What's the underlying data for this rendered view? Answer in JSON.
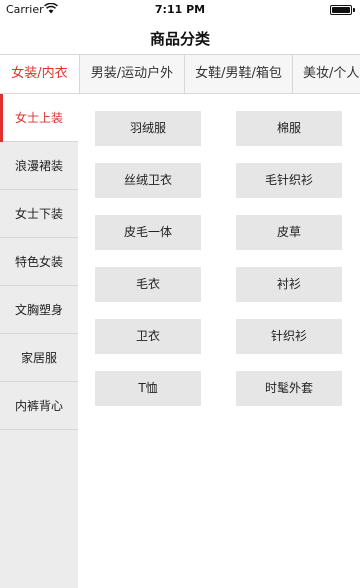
{
  "status_bar": {
    "carrier": "Carrier",
    "time": "7:11 PM"
  },
  "nav": {
    "title": "商品分类"
  },
  "tabs": [
    {
      "label": "女装/内衣",
      "active": true
    },
    {
      "label": "男装/运动户外",
      "active": false
    },
    {
      "label": "女鞋/男鞋/箱包",
      "active": false
    },
    {
      "label": "美妆/个人",
      "active": false
    }
  ],
  "sidebar": {
    "items": [
      {
        "label": "女士上装",
        "active": true
      },
      {
        "label": "浪漫裙装",
        "active": false
      },
      {
        "label": "女士下装",
        "active": false
      },
      {
        "label": "特色女装",
        "active": false
      },
      {
        "label": "文胸塑身",
        "active": false
      },
      {
        "label": "家居服",
        "active": false
      },
      {
        "label": "内裤背心",
        "active": false
      }
    ]
  },
  "categories": [
    "羽绒服",
    "棉服",
    "丝绒卫衣",
    "毛针织衫",
    "皮毛一体",
    "皮草",
    "毛衣",
    "衬衫",
    "卫衣",
    "针织衫",
    "T恤",
    "时髦外套"
  ],
  "colors": {
    "accent": "#e0312c",
    "sidebar_bg": "#ececec",
    "button_bg": "#e6e6e6"
  }
}
